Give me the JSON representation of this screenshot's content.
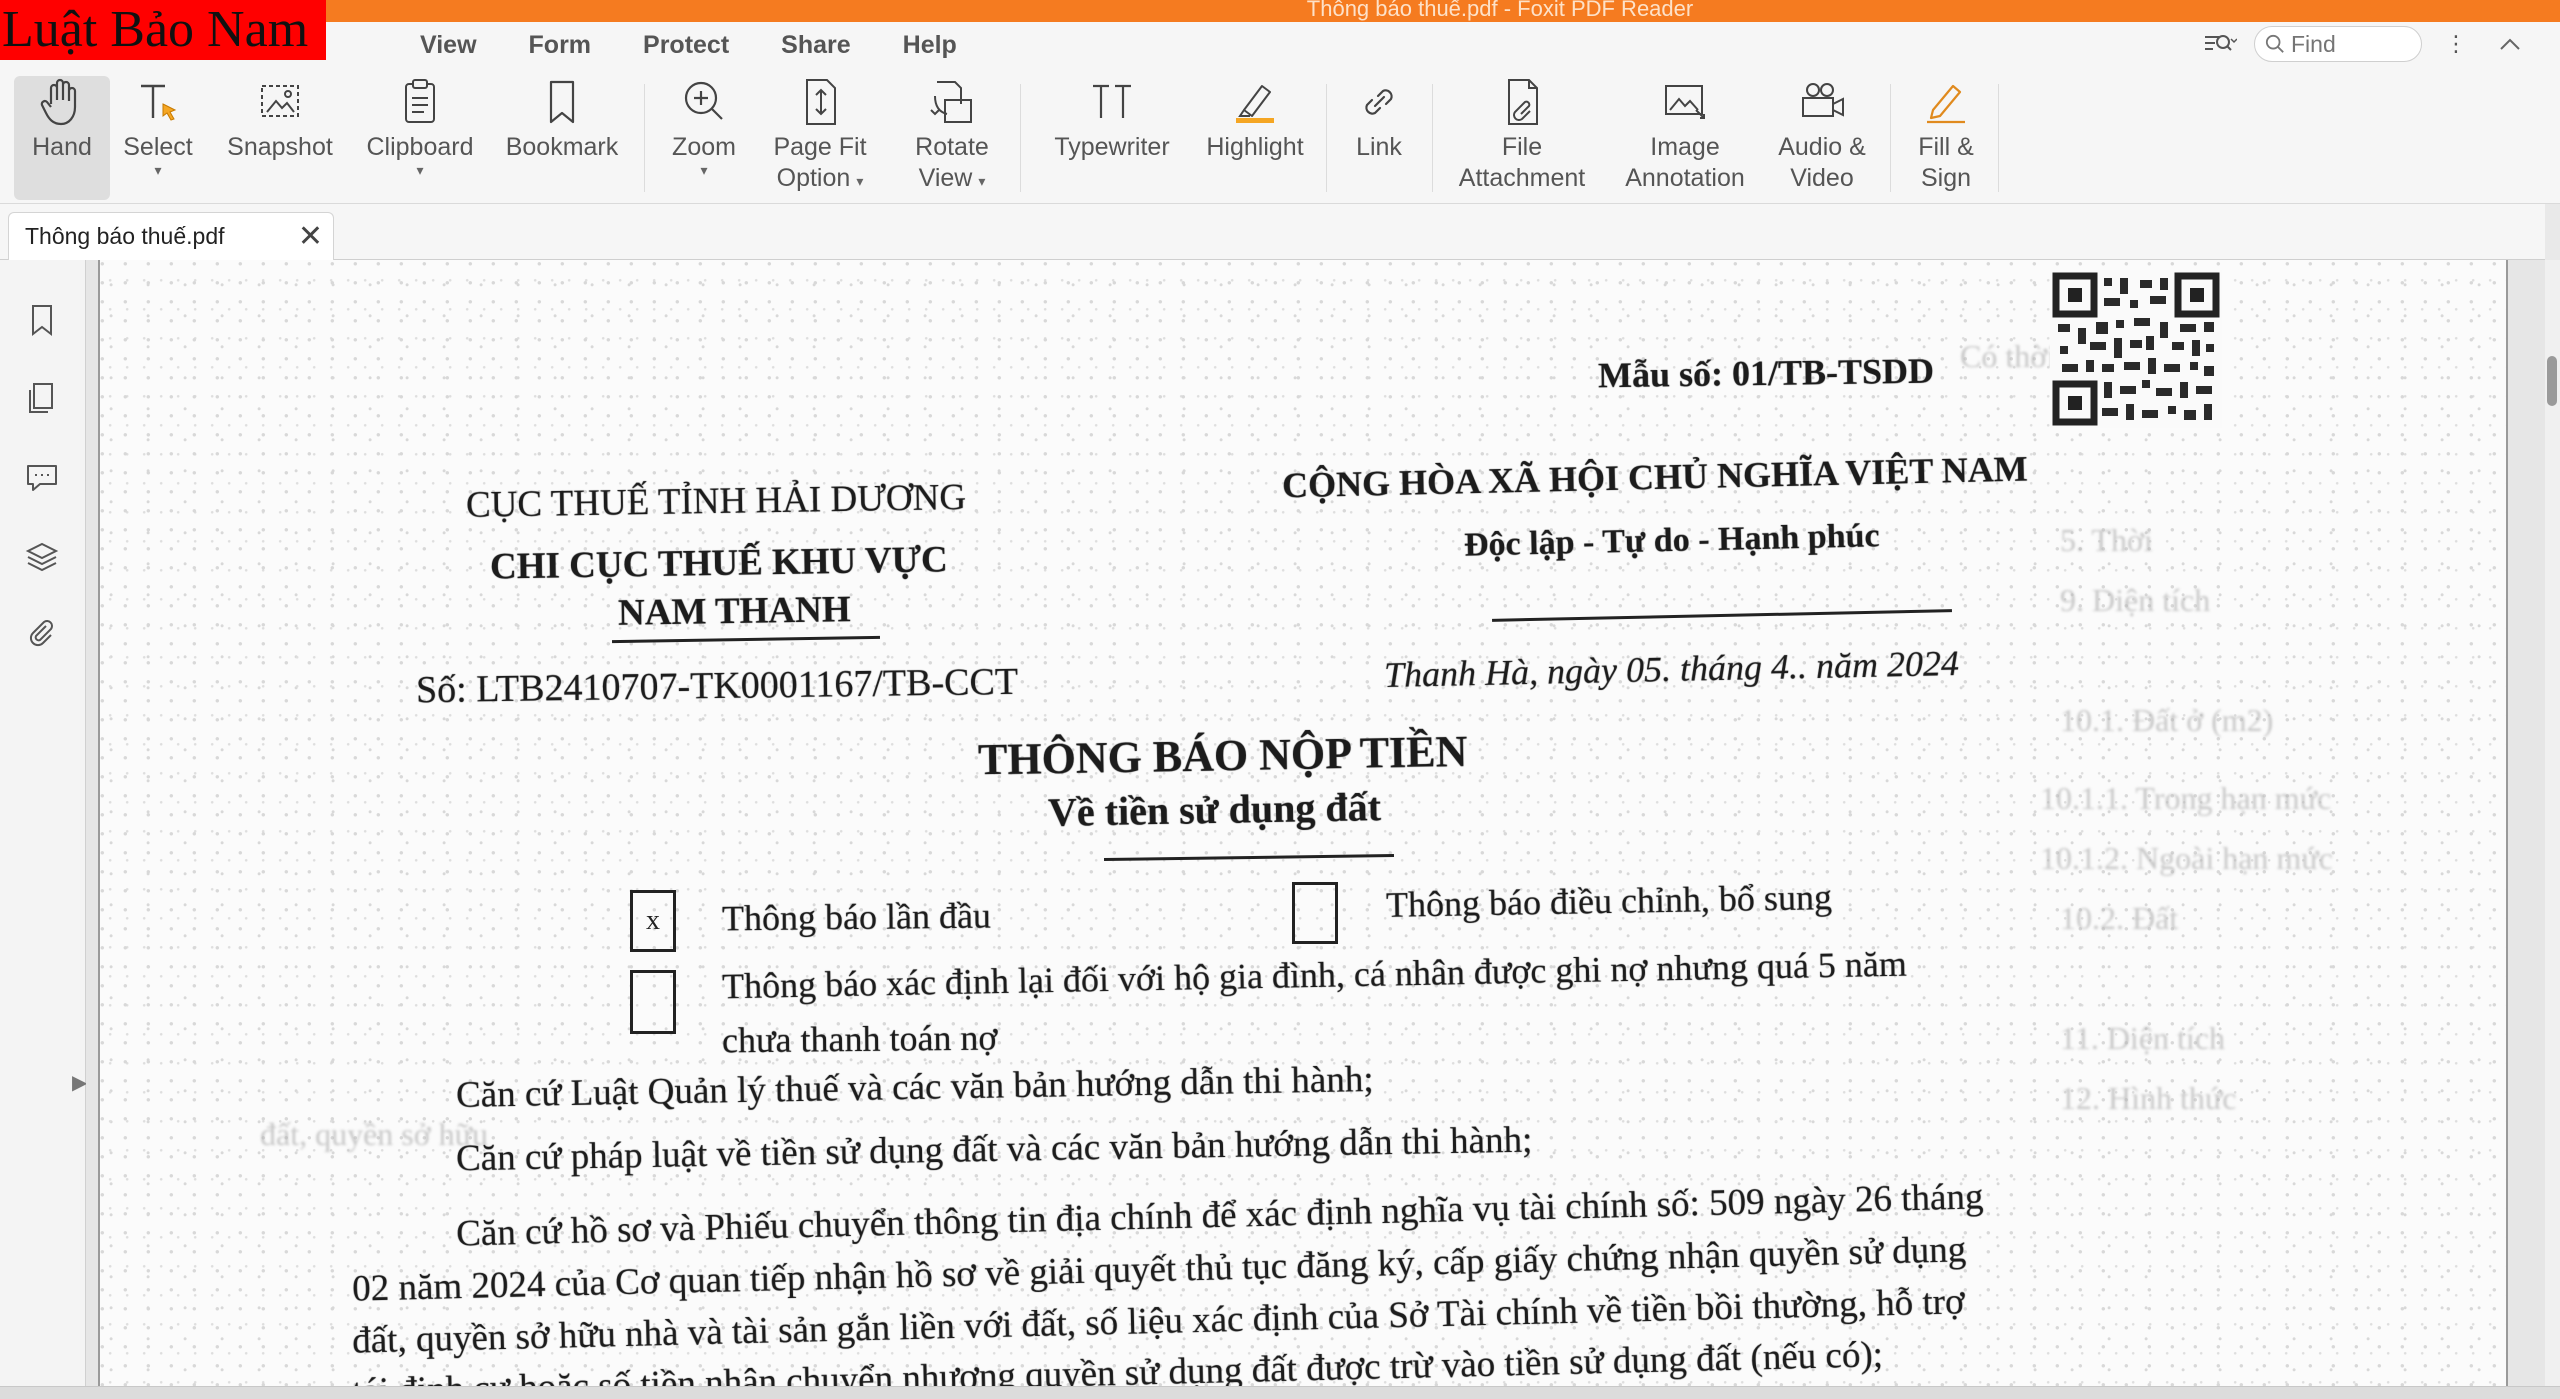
{
  "window": {
    "title": "Thông báo thuế.pdf - Foxit PDF Reader"
  },
  "watermark": "Luật Bảo Nam",
  "menu": [
    "View",
    "Form",
    "Protect",
    "Share",
    "Help"
  ],
  "search": {
    "placeholder": "Find"
  },
  "ribbon": {
    "hand": "Hand",
    "select": "Select",
    "snapshot": "Snapshot",
    "clipboard": "Clipboard",
    "bookmark": "Bookmark",
    "zoom": "Zoom",
    "page_fit_1": "Page Fit",
    "page_fit_2": "Option",
    "rotate_1": "Rotate",
    "rotate_2": "View",
    "typewriter": "Typewriter",
    "highlight": "Highlight",
    "link": "Link",
    "file_att_1": "File",
    "file_att_2": "Attachment",
    "image_ann_1": "Image",
    "image_ann_2": "Annotation",
    "audio_1": "Audio &",
    "audio_2": "Video",
    "fill_1": "Fill &",
    "fill_2": "Sign"
  },
  "tab": {
    "label": "Thông báo thuế.pdf"
  },
  "document": {
    "form_number": "Mẫu số: 01/TB-TSDD",
    "agency_1": "CỤC THUẾ TỈNH HẢI DƯƠNG",
    "agency_2": "CHI CỤC THUẾ KHU VỰC",
    "agency_3": "NAM THANH",
    "doc_number": "Số: LTB2410707-TK0001167/TB-CCT",
    "nation": "CỘNG HÒA XÃ HỘI CHỦ NGHĨA VIỆT NAM",
    "motto": "Độc lập - Tự do - Hạnh phúc",
    "place_date": "Thanh Hà, ngày 05. tháng 4.. năm 2024",
    "title": "THÔNG BÁO NỘP TIỀN",
    "subtitle": "Về tiền sử dụng đất",
    "check_mark": "x",
    "opt_first": "Thông báo lần đầu",
    "opt_adjust": "Thông báo điều chỉnh, bổ sung",
    "opt_redetermine_1": "Thông báo xác định lại đối với hộ gia đình, cá nhân được ghi nợ nhưng quá 5 năm",
    "opt_redetermine_2": "chưa thanh toán nợ",
    "basis_1": "Căn cứ Luật Quản lý thuế và các văn bản hướng dẫn thi hành;",
    "basis_2": "Căn cứ pháp luật về tiền sử dụng đất và các văn bản hướng dẫn thi hành;",
    "basis_3a": "Căn cứ hồ sơ và Phiếu chuyển thông tin địa chính để xác định nghĩa vụ tài chính số: 509 ngày 26 tháng",
    "basis_3b": "02 năm 2024 của Cơ quan tiếp nhận hồ sơ về giải quyết thủ tục đăng ký, cấp giấy chứng nhận quyền sử dụng",
    "basis_3c": "đất, quyền sở hữu nhà và tài sản gắn liền với đất, số liệu xác định của Sở Tài chính về tiền bồi thường, hỗ trợ",
    "basis_3d": "tái định cư hoặc số tiền nhận chuyển nhượng quyền sử dụng đất được trừ vào tiền sử dụng đất (nếu có);"
  },
  "colors": {
    "accent": "#f57b20",
    "watermark_bg": "#ff0000"
  }
}
